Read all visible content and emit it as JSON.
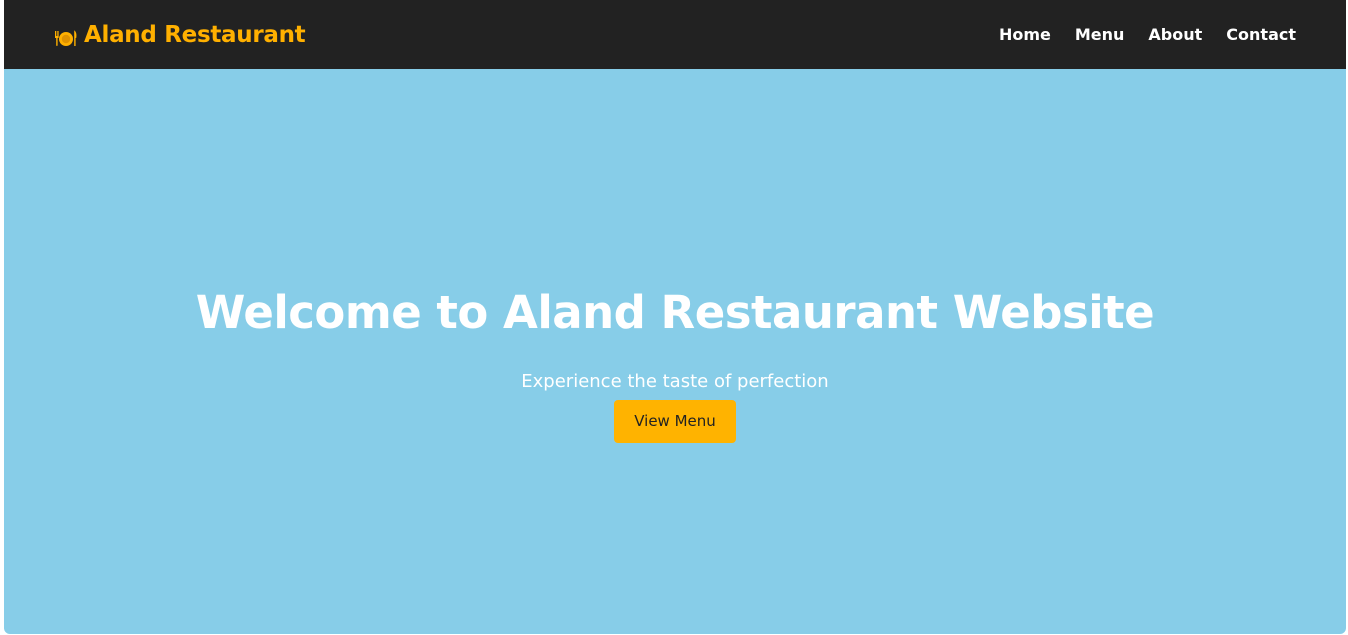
{
  "navbar": {
    "brand": {
      "icon": "plate-cutlery-icon",
      "text": "Aland Restaurant"
    },
    "links": [
      "Home",
      "Menu",
      "About",
      "Contact"
    ]
  },
  "hero": {
    "title": "Welcome to Aland Restaurant Website",
    "subtitle": "Experience the taste of perfection",
    "button_label": "View Menu"
  },
  "colors": {
    "navbar_bg": "#222222",
    "brand": "#ffb000",
    "hero_bg": "#87cde8",
    "button_bg": "#ffb300",
    "button_text": "#222222",
    "text_light": "#ffffff"
  }
}
